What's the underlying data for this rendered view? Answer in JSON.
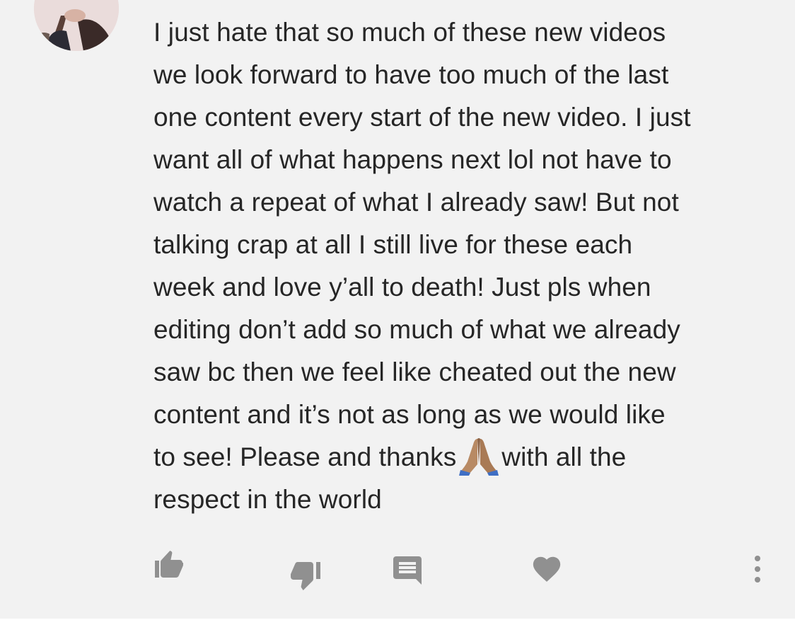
{
  "comment": {
    "avatar_icon": "user-avatar",
    "lines": [
      "I just hate that so much of these new videos",
      "we look forward to have too much of the last",
      "one content every start of the new video. I just",
      "want all of what happens next lol not have to",
      "watch a repeat of what I already saw! But not",
      "talking crap at all I still live for these each",
      "week and love y’all to death! Just pls when",
      "editing don’t add so much of what we already",
      "saw bc then we feel like cheated out the new",
      "content and it’s not as long as we would like"
    ],
    "line11_before_emoji": "to see! Please and thanks",
    "emoji_icon": "folded-hands-emoji",
    "line11_after_emoji": "with all the",
    "last_line": "respect in the world"
  },
  "actions": {
    "icon_color": "#909090",
    "items": [
      {
        "name": "like-button",
        "icon": "thumbs-up-icon"
      },
      {
        "name": "dislike-button",
        "icon": "thumbs-down-icon"
      },
      {
        "name": "reply-button",
        "icon": "comment-icon"
      },
      {
        "name": "heart-button",
        "icon": "heart-icon"
      },
      {
        "name": "more-options-button",
        "icon": "more-vert-icon"
      }
    ]
  }
}
